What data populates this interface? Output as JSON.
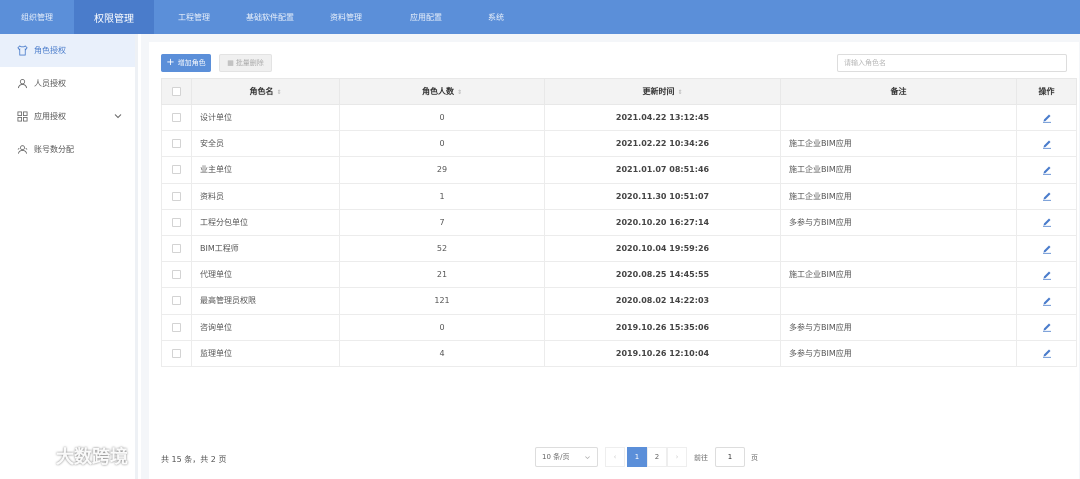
{
  "topnav": {
    "items": [
      "组织管理",
      "权限管理",
      "工程管理",
      "基础软件配置",
      "资料管理",
      "应用配置",
      "系统"
    ],
    "active_index": 1
  },
  "sidebar": {
    "items": [
      {
        "label": "角色授权",
        "icon": "shirt-icon",
        "active": true
      },
      {
        "label": "人员授权",
        "icon": "user-icon",
        "active": false
      },
      {
        "label": "应用授权",
        "icon": "grid-icon",
        "active": false,
        "expandable": true
      },
      {
        "label": "账号数分配",
        "icon": "users-icon",
        "active": false
      }
    ]
  },
  "toolbar": {
    "add_label": "增加角色",
    "delete_label": "批量删除",
    "search_placeholder": "请输入角色名"
  },
  "table": {
    "headers": [
      "角色名",
      "角色人数",
      "更新时间",
      "备注",
      "操作"
    ],
    "rows": [
      {
        "name": "设计单位",
        "count": "0",
        "time": "2021.04.22 13:12:45",
        "remark": ""
      },
      {
        "name": "安全员",
        "count": "0",
        "time": "2021.02.22 10:34:26",
        "remark": "施工企业BIM应用"
      },
      {
        "name": "业主单位",
        "count": "29",
        "time": "2021.01.07 08:51:46",
        "remark": "施工企业BIM应用"
      },
      {
        "name": "资料员",
        "count": "1",
        "time": "2020.11.30 10:51:07",
        "remark": "施工企业BIM应用"
      },
      {
        "name": "工程分包单位",
        "count": "7",
        "time": "2020.10.20 16:27:14",
        "remark": "多参与方BIM应用"
      },
      {
        "name": "BIM工程师",
        "count": "52",
        "time": "2020.10.04 19:59:26",
        "remark": ""
      },
      {
        "name": "代理单位",
        "count": "21",
        "time": "2020.08.25 14:45:55",
        "remark": "施工企业BIM应用"
      },
      {
        "name": "最高管理员权限",
        "count": "121",
        "time": "2020.08.02 14:22:03",
        "remark": ""
      },
      {
        "name": "咨询单位",
        "count": "0",
        "time": "2019.10.26 15:35:06",
        "remark": "多参与方BIM应用"
      },
      {
        "name": "监理单位",
        "count": "4",
        "time": "2019.10.26 12:10:04",
        "remark": "多参与方BIM应用"
      }
    ]
  },
  "pagination": {
    "total_text": "共 15 条，共 2 页",
    "page_size": "10 条/页",
    "pages": [
      "1",
      "2"
    ],
    "current_page": "1",
    "goto_label": "前往",
    "goto_value": "1",
    "goto_unit": "页"
  },
  "watermark": {
    "text": "大数跨境"
  },
  "colors": {
    "nav_bg": "#5b8fd9",
    "nav_active": "#4a7ccb",
    "accent": "#5b8fd9"
  }
}
